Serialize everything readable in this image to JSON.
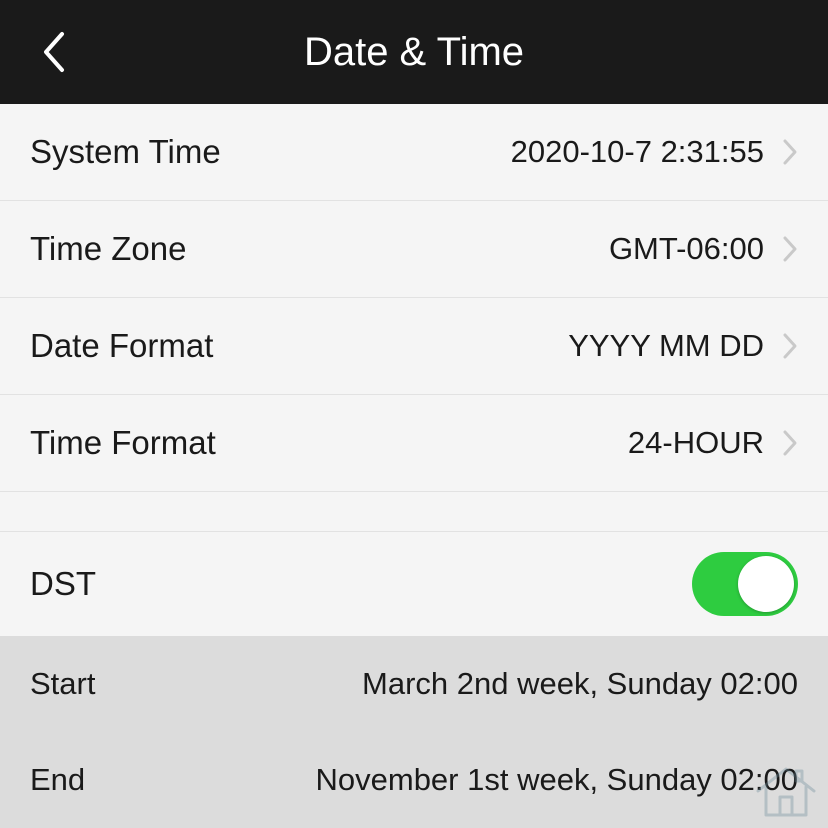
{
  "header": {
    "title": "Date & Time"
  },
  "rows": {
    "system_time": {
      "label": "System Time",
      "value": "2020-10-7 2:31:55"
    },
    "time_zone": {
      "label": "Time Zone",
      "value": "GMT-06:00"
    },
    "date_format": {
      "label": "Date Format",
      "value": "YYYY MM DD"
    },
    "time_format": {
      "label": "Time Format",
      "value": "24-HOUR"
    }
  },
  "dst": {
    "label": "DST",
    "enabled": true,
    "start": {
      "label": "Start",
      "value": "March 2nd week, Sunday 02:00"
    },
    "end": {
      "label": "End",
      "value": "November 1st week, Sunday 02:00"
    }
  },
  "colors": {
    "toggle_on": "#2ecc40",
    "header_bg": "#1a1a1a"
  }
}
